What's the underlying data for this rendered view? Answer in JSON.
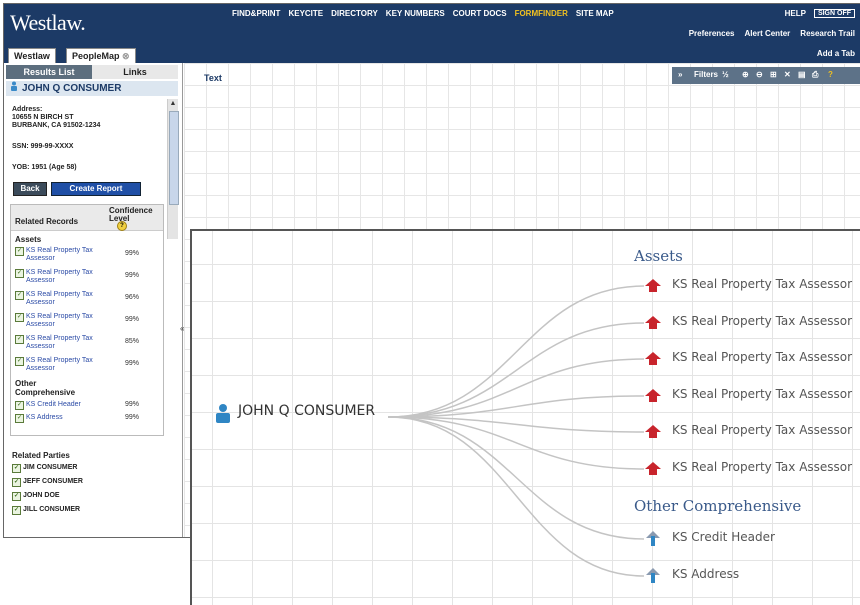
{
  "app": {
    "logo": "Westlaw.",
    "nav": [
      "FIND&PRINT",
      "KEYCITE",
      "DIRECTORY",
      "KEY NUMBERS",
      "COURT DOCS",
      "FORMFINDER",
      "SITE MAP"
    ],
    "nav_active": "FORMFINDER",
    "help": "HELP",
    "signoff": "SIGN OFF",
    "links": [
      "Preferences",
      "Alert Center",
      "Research Trail"
    ],
    "add_tab": "Add a Tab",
    "tabs": [
      "Westlaw",
      "PeopleMap"
    ]
  },
  "sidebar": {
    "tabs": [
      "Results List",
      "Links"
    ],
    "person": "JOHN Q CONSUMER",
    "address_label": "Address:",
    "address_lines": [
      "10655 N BIRCH ST",
      "BURBANK, CA 91502-1234"
    ],
    "ssn": "SSN: 999-99-XXXX",
    "yob": "YOB: 1951 (Age 58)",
    "back": "Back",
    "create_report": "Create Report",
    "related_records": "Related Records",
    "confidence": "Confidence Level",
    "sections": [
      {
        "title": "Assets",
        "records": [
          {
            "name": "KS Real Property Tax Assessor",
            "pct": "99%"
          },
          {
            "name": "KS Real Property Tax Assessor",
            "pct": "99%"
          },
          {
            "name": "KS Real Property Tax Assessor",
            "pct": "96%"
          },
          {
            "name": "KS Real Property Tax Assessor",
            "pct": "99%"
          },
          {
            "name": "KS Real Property Tax Assessor",
            "pct": "85%"
          },
          {
            "name": "KS Real Property Tax Assessor",
            "pct": "99%"
          }
        ]
      },
      {
        "title": "Other Comprehensive",
        "records": [
          {
            "name": "KS Credit Header",
            "pct": "99%"
          },
          {
            "name": "KS Address",
            "pct": "99%"
          }
        ]
      }
    ],
    "related_parties": "Related Parties",
    "parties": [
      "JIM CONSUMER",
      "JEFF CONSUMER",
      "JOHN DOE",
      "JILL CONSUMER"
    ]
  },
  "main": {
    "text_link": "Text",
    "toolbar": [
      "»",
      "Filters",
      "½",
      "⊕",
      "⊖",
      "⊞",
      "✕",
      "▤",
      "⎙",
      "?"
    ]
  },
  "zoom": {
    "root": "JOHN Q CONSUMER",
    "assets_title": "Assets",
    "assets": [
      "KS Real Property Tax Assessor",
      "KS Real Property Tax Assessor",
      "KS Real Property Tax Assessor",
      "KS Real Property Tax Assessor",
      "KS Real Property Tax Assessor",
      "KS Real Property Tax Assessor"
    ],
    "other_title": "Other Comprehensive",
    "other": [
      "KS Credit Header",
      "KS Address"
    ]
  }
}
